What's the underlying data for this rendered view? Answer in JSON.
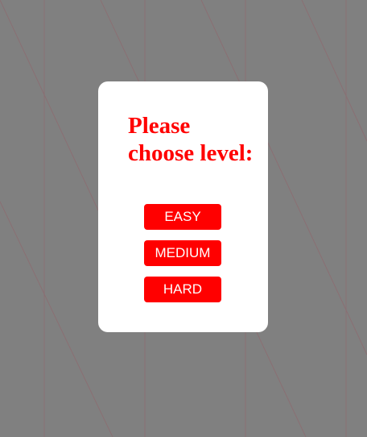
{
  "colors": {
    "background": "#808080",
    "grid_line": "#8a6f73",
    "dialog": "#ffffff",
    "accent": "#ff0000",
    "button_text": "#ffffff"
  },
  "dialog": {
    "title": "Please choose level:",
    "buttons": {
      "easy": "EASY",
      "medium": "MEDIUM",
      "hard": "HARD"
    }
  }
}
